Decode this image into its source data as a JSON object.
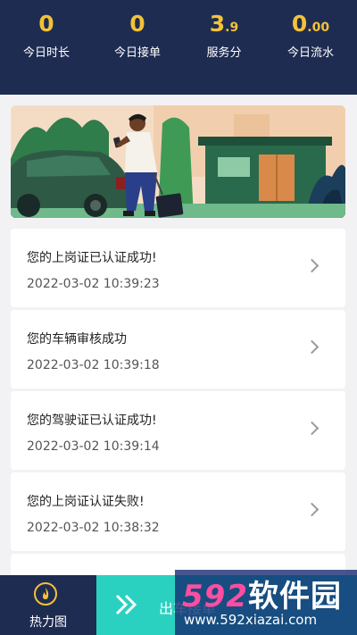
{
  "stats": [
    {
      "value": "0",
      "fraction": "",
      "label": "今日时长"
    },
    {
      "value": "0",
      "fraction": "",
      "label": "今日接单"
    },
    {
      "value": "3",
      "fraction": ".9",
      "label": "服务分"
    },
    {
      "value": "0",
      "fraction": ".00",
      "label": "今日流水"
    }
  ],
  "notifications": [
    {
      "title": "您的上岗证已认证成功!",
      "time": "2022-03-02 10:39:23"
    },
    {
      "title": "您的车辆审核成功",
      "time": "2022-03-02 10:39:18"
    },
    {
      "title": "您的驾驶证已认证成功!",
      "time": "2022-03-02 10:39:14"
    },
    {
      "title": "您的上岗证认证失败!",
      "time": "2022-03-02 10:38:32"
    }
  ],
  "bottom": {
    "heat_label": "热力图",
    "go_label": "出车接单"
  },
  "watermark": {
    "brand_digits": "592",
    "brand_cn": "软件园",
    "url": "www.592xiazai.com"
  },
  "colors": {
    "header_bg": "#1f2c52",
    "accent_yellow": "#f3c236",
    "go_button": "#2ad1c0"
  },
  "icons": {
    "chevron": "chevron-right-icon",
    "heat": "flame-icon",
    "go": "double-chevron-right-icon"
  }
}
